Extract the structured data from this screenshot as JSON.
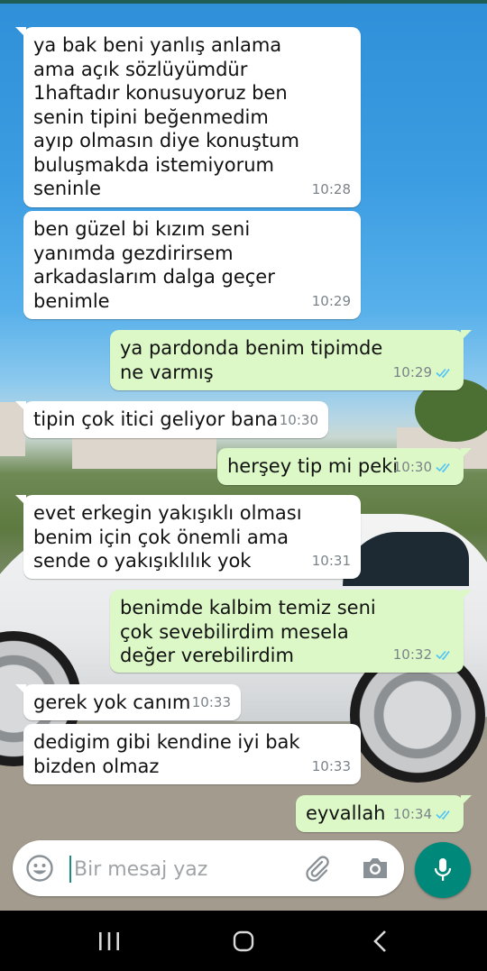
{
  "colors": {
    "header_strip": "#1f5e57",
    "incoming_bubble": "#ffffff",
    "outgoing_bubble": "#dcf8c6",
    "timestamp": "#7b8389",
    "read_ticks": "#4fc3f7",
    "mic_button": "#00897b"
  },
  "messages": [
    {
      "direction": "in",
      "text": "ya bak beni yanlış anlama\nama açık sözlüyümdür\n1haftadır konusuyoruz ben\nsenin tipini beğenmedim\nayıp olmasın diye konuştum\nbuluşmakda istemiyorum\nseninle",
      "time": "10:28"
    },
    {
      "direction": "in",
      "text": "ben güzel bi kızım seni\nyanımda gezdirirsem\narkadaslarım dalga geçer\nbenimle",
      "time": "10:29"
    },
    {
      "direction": "out",
      "text": "ya pardonda benim tipimde\nne varmış",
      "time": "10:29",
      "status": "read"
    },
    {
      "direction": "in",
      "text": "tipin çok itici geliyor bana",
      "time": "10:30"
    },
    {
      "direction": "out",
      "text": "herşey tip mi peki",
      "time": "10:30",
      "status": "read"
    },
    {
      "direction": "in",
      "text": "evet erkegin yakışıklı olması\nbenim için çok önemli ama\nsende o yakışıklılık yok",
      "time": "10:31"
    },
    {
      "direction": "out",
      "text": "benimde kalbim temiz seni\nçok sevebilirdim mesela\ndeğer verebilirdim",
      "time": "10:32",
      "status": "read"
    },
    {
      "direction": "in",
      "text": "gerek yok canım",
      "time": "10:33"
    },
    {
      "direction": "in",
      "text": "dedigim gibi kendine iyi bak\nbizden olmaz",
      "time": "10:33"
    },
    {
      "direction": "out",
      "text": "eyvallah",
      "time": "10:34",
      "status": "read"
    }
  ],
  "composer": {
    "placeholder": "Bir mesaj yaz",
    "value": "",
    "emoji_icon": "emoji-icon",
    "attach_icon": "paperclip-icon",
    "camera_icon": "camera-icon",
    "send_icon": "microphone-icon"
  },
  "navbar": {
    "recents_icon": "recents-icon",
    "home_icon": "home-icon",
    "back_icon": "back-icon"
  }
}
